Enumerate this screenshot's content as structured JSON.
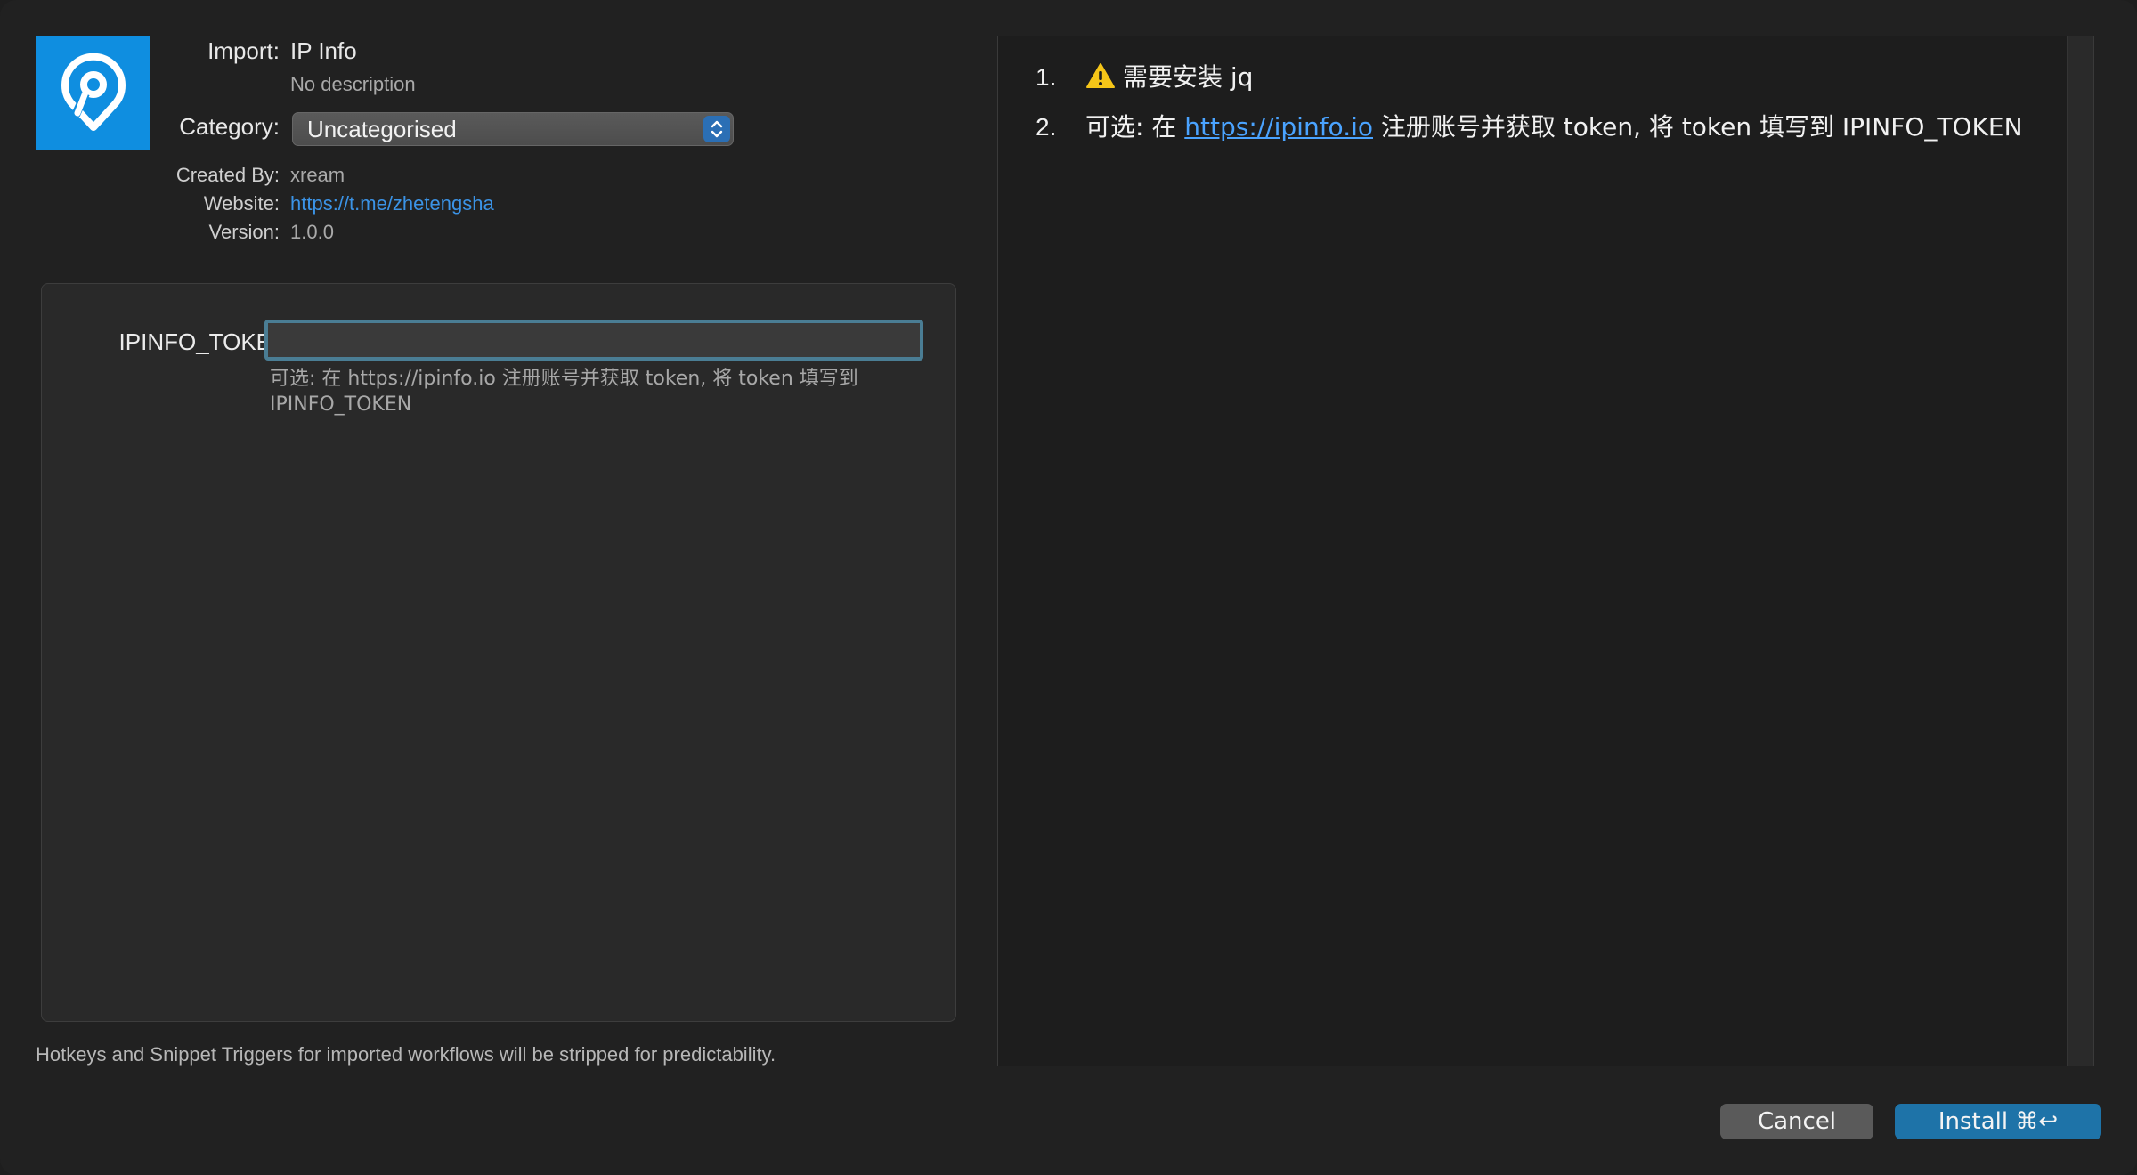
{
  "window": {
    "accent_color": "#0f8ee0",
    "icon": "location-pin-icon"
  },
  "meta": {
    "import_label": "Import:",
    "import_value": "IP Info",
    "description": "No description",
    "category_label": "Category:",
    "category_value": "Uncategorised",
    "created_by_label": "Created By:",
    "created_by_value": "xream",
    "website_label": "Website:",
    "website_value": "https://t.me/zhetengsha",
    "version_label": "Version:",
    "version_value": "1.0.0"
  },
  "variables": {
    "token_label": "IPINFO_TOKEN:",
    "token_value": "",
    "token_help": "可选: 在 https://ipinfo.io 注册账号并获取 token, 将 token 填写到 IPINFO_TOKEN"
  },
  "footer_note": "Hotkeys and Snippet Triggers for imported workflows will be stripped for predictability.",
  "readme": {
    "item1_num": "1.",
    "item1_text": "需要安装 jq",
    "item2_num": "2.",
    "item2_prefix": "可选: 在 ",
    "item2_link": "https://ipinfo.io",
    "item2_suffix": " 注册账号并获取 token, 将 token 填写到 IPINFO_TOKEN"
  },
  "buttons": {
    "cancel": "Cancel",
    "install": "Install ⌘↩"
  }
}
